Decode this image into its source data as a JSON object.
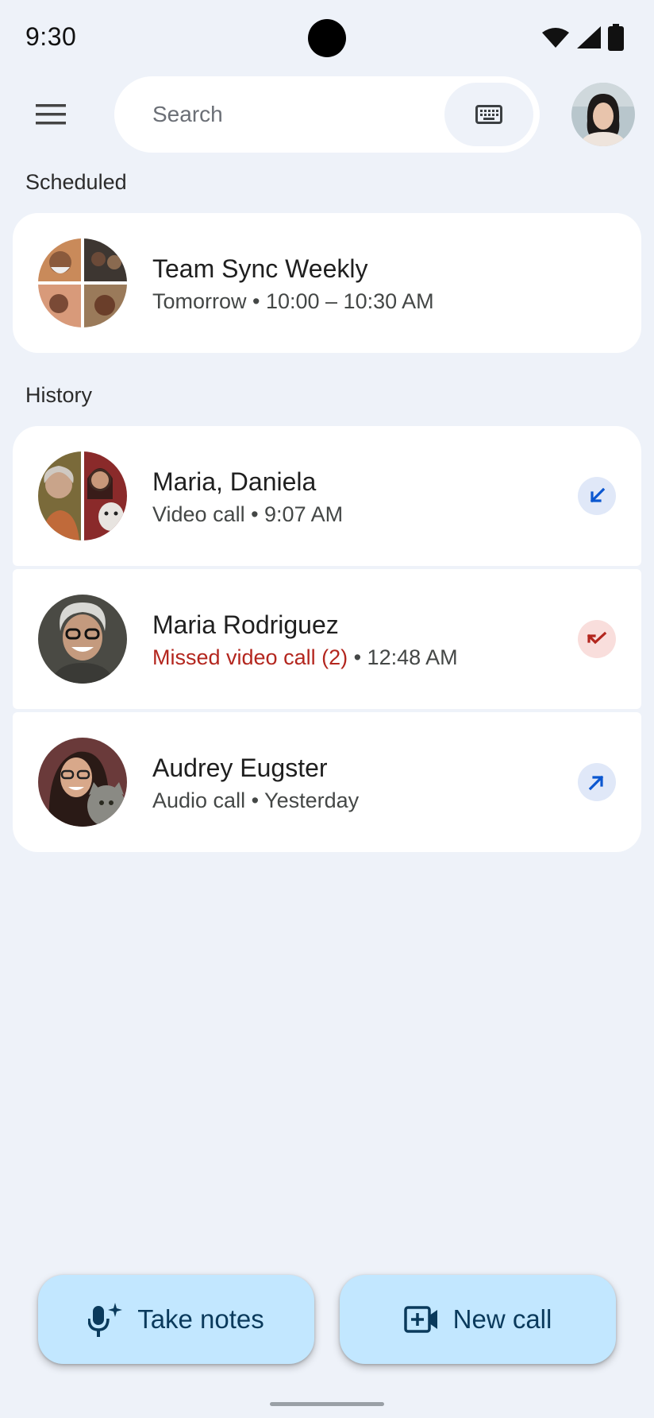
{
  "status_bar": {
    "time": "9:30"
  },
  "search": {
    "placeholder": "Search"
  },
  "sections": {
    "scheduled": "Scheduled",
    "history": "History"
  },
  "scheduled": {
    "title": "Team Sync Weekly",
    "subtitle": "Tomorrow • 10:00 – 10:30 AM"
  },
  "history": [
    {
      "name": "Maria, Daniela",
      "detail": "Video call • 9:07 AM",
      "direction": "incoming-arrow-icon"
    },
    {
      "name": "Maria Rodriguez",
      "missed": "Missed video call (2)",
      "detail": " • 12:48 AM",
      "direction": "missed-call-icon"
    },
    {
      "name": "Audrey Eugster",
      "detail": "Audio call • Yesterday",
      "direction": "outgoing-arrow-icon"
    }
  ],
  "actions": {
    "take_notes": "Take notes",
    "new_call": "New call"
  },
  "colors": {
    "background": "#eef2f9",
    "fab": "#c2e7ff",
    "missed": "#b3261e",
    "accent": "#0b57d0"
  }
}
